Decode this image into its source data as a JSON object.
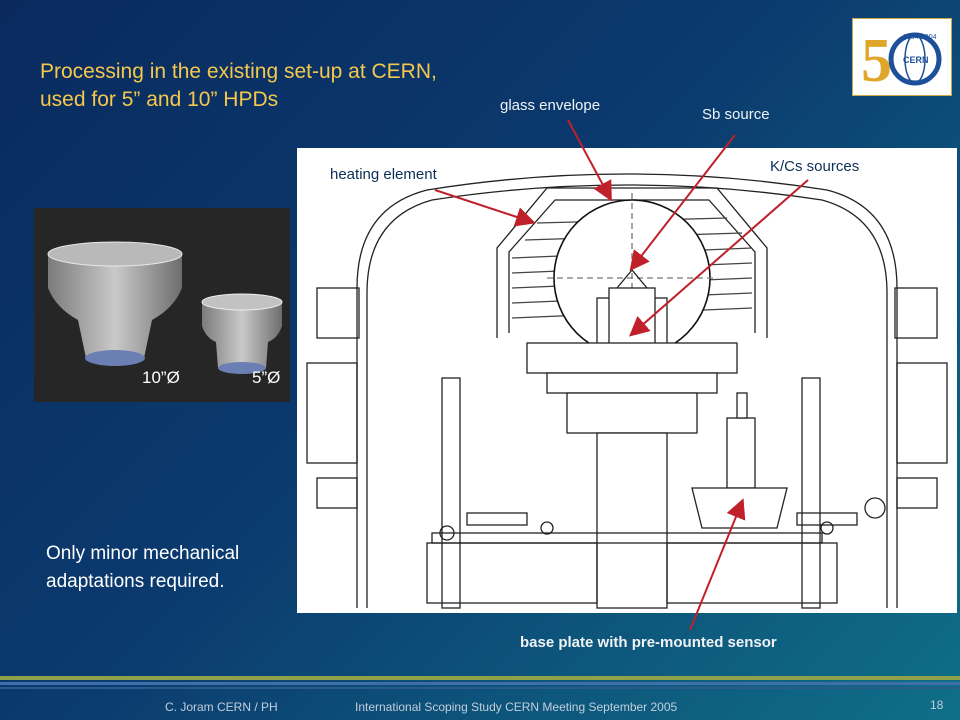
{
  "slide": {
    "title": "Processing in the existing set-up at CERN,\nused for 5” and 10” HPDs",
    "logo": {
      "years": "1954-2004",
      "text": "CERN"
    },
    "photo_labels": {
      "large": "10”Ø",
      "small": "5”Ø"
    },
    "annotations": {
      "glass_envelope": "glass envelope",
      "sb_source": "Sb source",
      "heating_element": "heating element",
      "kcs_sources": "K/Cs sources",
      "base_plate": "base plate with pre-mounted sensor"
    },
    "note": "Only minor mechanical\nadaptations required.",
    "footer": {
      "author": "C. Joram  CERN / PH",
      "event": "International Scoping Study   CERN  Meeting    September 2005",
      "page": "18"
    },
    "colors": {
      "title": "#f5c84c",
      "arrow": "#c0202a",
      "background": "#0b3a6e"
    }
  }
}
